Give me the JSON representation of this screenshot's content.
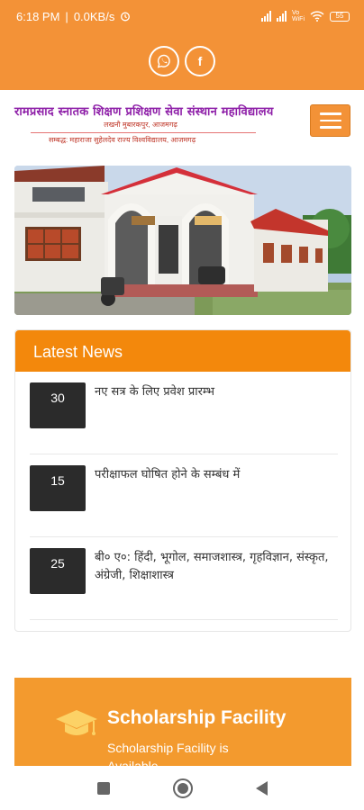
{
  "status_bar": {
    "time": "6:18 PM",
    "speed": "0.0KB/s",
    "battery": "55",
    "alarm_icon": "alarm-icon",
    "wifi_icon": "wifi-icon"
  },
  "social": {
    "whatsapp_icon": "whatsapp-icon",
    "facebook_icon": "facebook-icon",
    "facebook_glyph": "f"
  },
  "header": {
    "college_name": "रामप्रसाद स्नातक शिक्षण प्रशिक्षण सेवा संस्थान महाविद्यालय",
    "address": "लखनौ मुबारकपुर, आजमगढ़",
    "affiliation": "सम्बद्ध: महाराजा सुहेलदेव राज्य विश्वविद्यालय, आजमगढ़",
    "menu_icon": "hamburger-menu-icon"
  },
  "latest_news": {
    "heading": "Latest News",
    "items": [
      {
        "date": "30",
        "text": "नए सत्र के लिए प्रवेश प्रारम्भ"
      },
      {
        "date": "15",
        "text": "परीक्षाफल घोषित होने के सम्बंध में"
      },
      {
        "date": "25",
        "text": "बी० ए०: हिंदी, भूगोल, समाजशास्त्र, गृहविज्ञान, संस्कृत, अंग्रेजी, शिक्षाशास्त्र"
      }
    ]
  },
  "scholarship": {
    "icon": "graduation-cap-icon",
    "title": "Scholarship Facility",
    "text": "Scholarship Facility is Available"
  },
  "colors": {
    "accent": "#f39237",
    "news_header": "#f3880c",
    "college_name": "#8e1fa8",
    "date_box": "#2b2b2b"
  }
}
